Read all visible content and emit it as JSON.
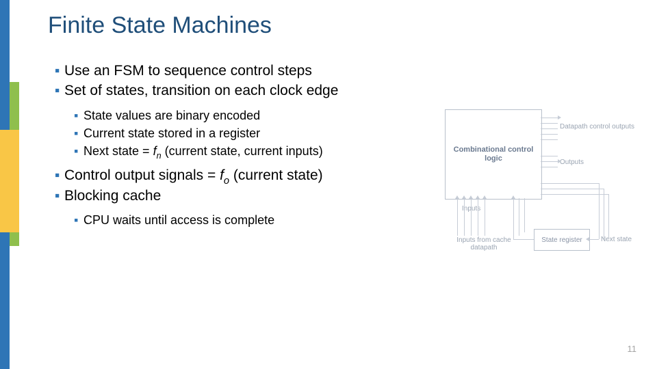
{
  "title": "Finite State Machines",
  "page_number": "11",
  "bullets": {
    "p1": "Use an FSM to sequence control steps",
    "p2": "Set of states, transition on each clock edge",
    "p2a": "State values are binary encoded",
    "p2b": "Current state stored in a register",
    "p2c_pre": "Next state = ",
    "p2c_f": "f",
    "p2c_sub": "n",
    "p2c_post": " (current state, current inputs)",
    "p3_pre": "Control output signals = ",
    "p3_f": "f",
    "p3_sub": "o",
    "p3_post": " (current state)",
    "p4": "Blocking cache",
    "p4a": "CPU waits until access is complete"
  },
  "diagram": {
    "logic_label": "Combinational control logic",
    "reg_label": "State register",
    "dco": "Datapath control outputs",
    "outputs": "Outputs",
    "inputs_label": "Inputs from cache datapath",
    "inputs_short": "Inputs",
    "next_state": "Next state"
  }
}
